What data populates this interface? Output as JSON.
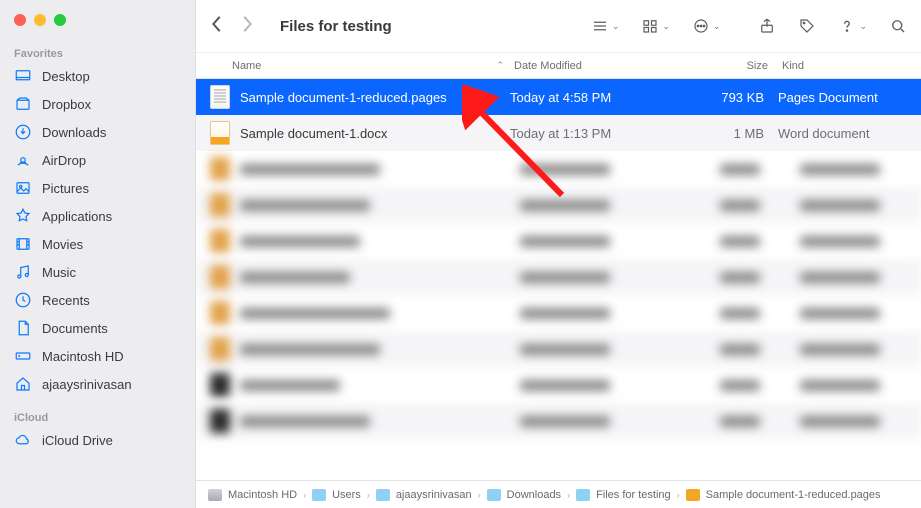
{
  "window": {
    "title": "Files for testing"
  },
  "sidebar": {
    "sections": [
      {
        "label": "Favorites",
        "items": [
          {
            "icon": "desktop",
            "label": "Desktop"
          },
          {
            "icon": "dropbox",
            "label": "Dropbox"
          },
          {
            "icon": "download",
            "label": "Downloads"
          },
          {
            "icon": "airdrop",
            "label": "AirDrop"
          },
          {
            "icon": "pictures",
            "label": "Pictures"
          },
          {
            "icon": "apps",
            "label": "Applications"
          },
          {
            "icon": "movies",
            "label": "Movies"
          },
          {
            "icon": "music",
            "label": "Music"
          },
          {
            "icon": "recents",
            "label": "Recents"
          },
          {
            "icon": "documents",
            "label": "Documents"
          },
          {
            "icon": "hd",
            "label": "Macintosh HD"
          },
          {
            "icon": "home",
            "label": "ajaaysrinivasan"
          }
        ]
      },
      {
        "label": "iCloud",
        "items": [
          {
            "icon": "icloud",
            "label": "iCloud Drive"
          }
        ]
      }
    ]
  },
  "columns": {
    "name": "Name",
    "date": "Date Modified",
    "size": "Size",
    "kind": "Kind"
  },
  "files": [
    {
      "name": "Sample document-1-reduced.pages",
      "date": "Today at 4:58 PM",
      "size": "793 KB",
      "kind": "Pages Document",
      "type": "pages",
      "selected": true
    },
    {
      "name": "Sample document-1.docx",
      "date": "Today at 1:13 PM",
      "size": "1 MB",
      "kind": "Word document",
      "type": "docx",
      "selected": false
    }
  ],
  "path": [
    {
      "icon": "hd",
      "label": "Macintosh HD"
    },
    {
      "icon": "folder",
      "label": "Users"
    },
    {
      "icon": "folder",
      "label": "ajaaysrinivasan"
    },
    {
      "icon": "folder",
      "label": "Downloads"
    },
    {
      "icon": "folder",
      "label": "Files for testing"
    },
    {
      "icon": "doc",
      "label": "Sample document-1-reduced.pages"
    }
  ]
}
